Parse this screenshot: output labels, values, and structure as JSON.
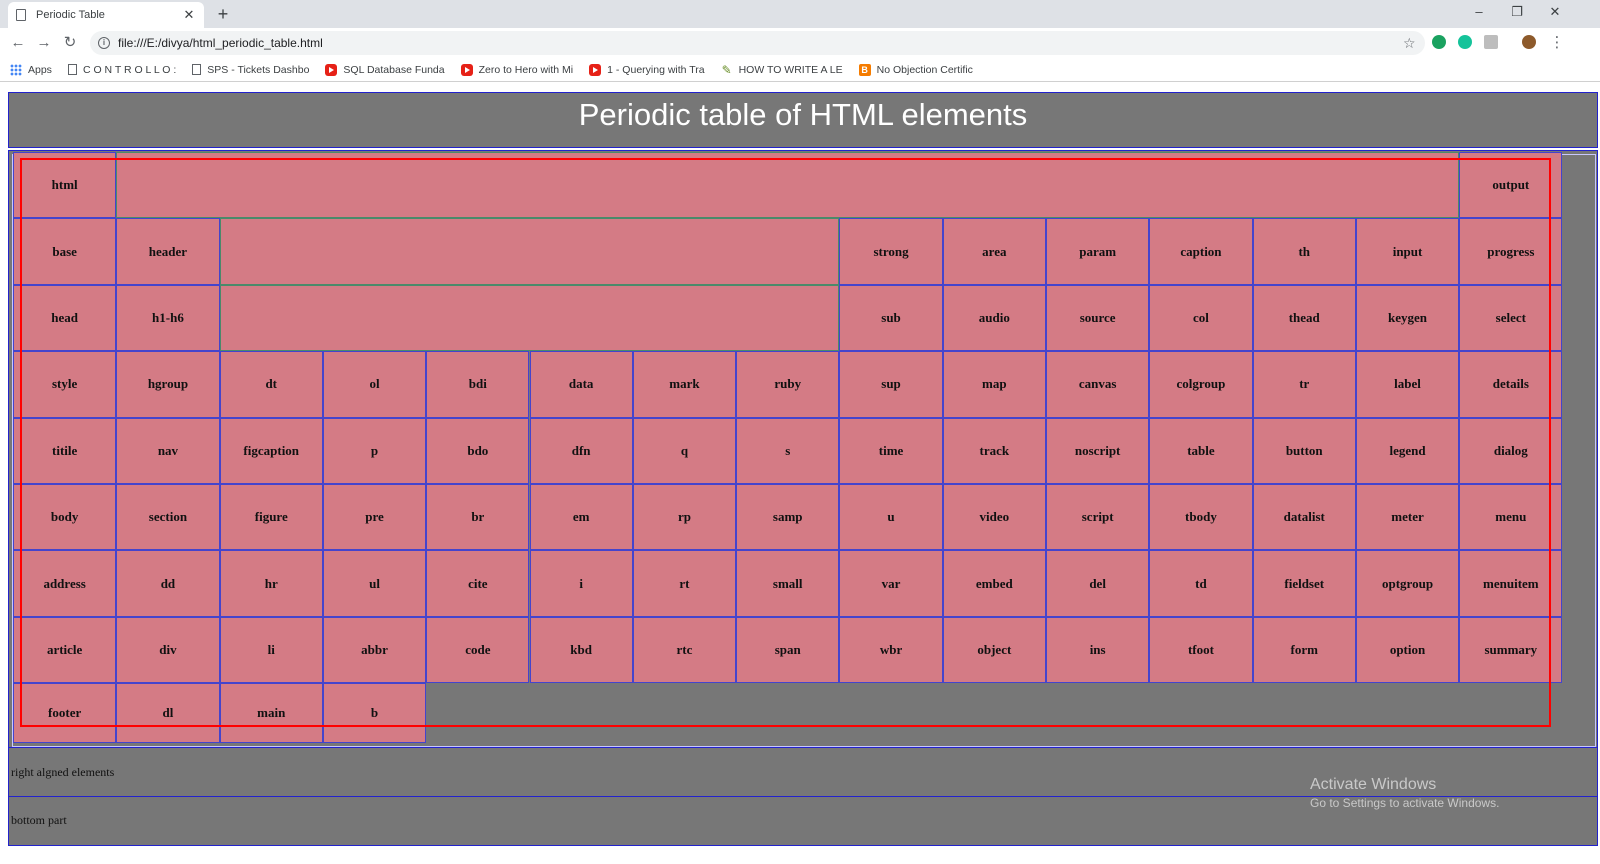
{
  "browser": {
    "tab_title": "Periodic Table",
    "url": "file:///E:/divya/html_periodic_table.html",
    "bookmarks": [
      {
        "label": "Apps",
        "icon": "apps-grid-icon"
      },
      {
        "label": "C O N T R O L L O :",
        "icon": "document-icon"
      },
      {
        "label": "SPS - Tickets Dashbo",
        "icon": "document-icon"
      },
      {
        "label": "SQL Database Funda",
        "icon": "youtube-icon"
      },
      {
        "label": "Zero to Hero with Mi",
        "icon": "youtube-icon"
      },
      {
        "label": "1 - Querying with Tra",
        "icon": "youtube-icon"
      },
      {
        "label": "HOW TO WRITE A LE",
        "icon": "pen-icon"
      },
      {
        "label": "No Objection Certific",
        "icon": "blogger-icon"
      }
    ]
  },
  "page": {
    "title": "Periodic table of HTML elements",
    "right_section": "right algned elements",
    "bottom_section": "bottom part"
  },
  "rows": [
    [
      "html",
      "",
      "output"
    ],
    [
      "base",
      "header",
      "",
      "strong",
      "area",
      "param",
      "caption",
      "th",
      "input",
      "progress"
    ],
    [
      "head",
      "h1-h6",
      "",
      "sub",
      "audio",
      "source",
      "col",
      "thead",
      "keygen",
      "select"
    ],
    [
      "style",
      "hgroup",
      "dt",
      "ol",
      "bdi",
      "data",
      "mark",
      "ruby",
      "sup",
      "map",
      "canvas",
      "colgroup",
      "tr",
      "label",
      "details"
    ],
    [
      "titile",
      "nav",
      "figcaption",
      "p",
      "bdo",
      "dfn",
      "q",
      "s",
      "time",
      "track",
      "noscript",
      "table",
      "button",
      "legend",
      "dialog"
    ],
    [
      "body",
      "section",
      "figure",
      "pre",
      "br",
      "em",
      "rp",
      "samp",
      "u",
      "video",
      "script",
      "tbody",
      "datalist",
      "meter",
      "menu"
    ],
    [
      "address",
      "dd",
      "hr",
      "ul",
      "cite",
      "i",
      "rt",
      "small",
      "var",
      "embed",
      "del",
      "td",
      "fieldset",
      "optgroup",
      "menuitem"
    ],
    [
      "article",
      "div",
      "li",
      "abbr",
      "code",
      "kbd",
      "rtc",
      "span",
      "wbr",
      "object",
      "ins",
      "tfoot",
      "form",
      "option",
      "summary"
    ],
    [
      "footer",
      "dl",
      "main",
      "b"
    ]
  ],
  "watermark": {
    "line1": "Activate Windows",
    "line2": "Go to Settings to activate Windows."
  },
  "colors": {
    "cell_fill": "#d47b85",
    "cell_border": "#4444cc",
    "background": "#777777",
    "outline": "#ff0000"
  }
}
